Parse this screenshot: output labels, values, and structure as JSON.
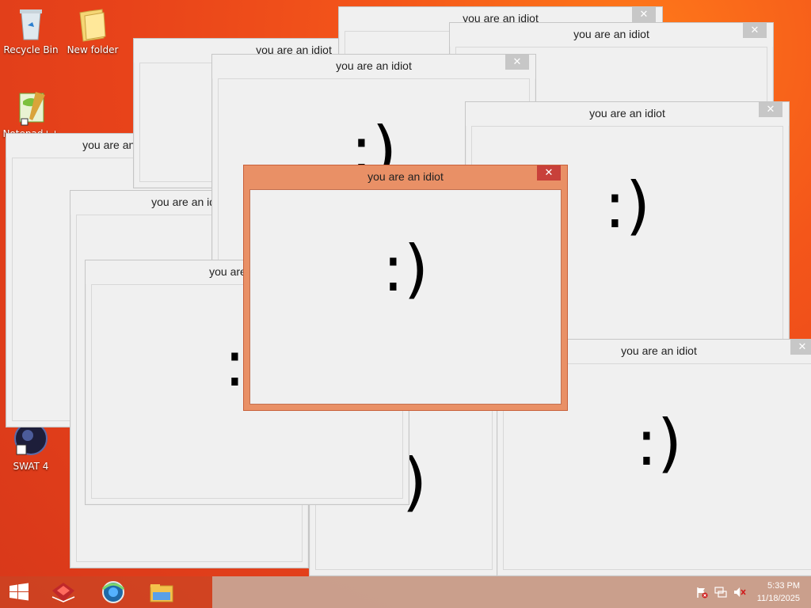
{
  "desktop": {
    "icons": [
      {
        "label": "Recycle Bin"
      },
      {
        "label": "New folder"
      },
      {
        "label": "Notepad++"
      },
      {
        "label": "SWAT 4"
      }
    ]
  },
  "windows": [
    {
      "title": "you are an idiot",
      "close": "✕",
      "smile": ":)"
    },
    {
      "title": "you are an idiot",
      "close": "✕",
      "smile": ":)"
    },
    {
      "title": "you are an idiot",
      "close": "✕",
      "smile": ":)"
    },
    {
      "title": "you are an idiot",
      "close": "✕",
      "smile": ":)"
    },
    {
      "title": "you are an idiot",
      "close": "✕",
      "smile": ":)"
    },
    {
      "title": "you are an idiot",
      "close": "✕",
      "smile": ":)"
    },
    {
      "title": "you are an idiot",
      "close": "✕",
      "smile": ":)"
    },
    {
      "title": "you are an idiot",
      "close": "✕",
      "smile": ":)"
    },
    {
      "title": "you are an idiot",
      "close": "✕",
      "smile": ":)"
    },
    {
      "title": "you are an idiot",
      "close": "✕",
      "smile": ":)"
    }
  ],
  "taskbar": {
    "apps": [
      {
        "name": "windows-start-icon"
      },
      {
        "name": "app-red-icon"
      },
      {
        "name": "browser-icon"
      },
      {
        "name": "file-explorer-icon"
      }
    ],
    "tray": {
      "icons": [
        "flag-icon",
        "network-icon",
        "volume-muted-icon"
      ]
    },
    "clock": {
      "time": "5:33 PM",
      "date": "11/18/2025"
    }
  },
  "colors": {
    "desktop_background": "#e8431a",
    "active_title": "#e99066",
    "close_active": "#c8403a",
    "close_inactive": "#c7c7c7"
  }
}
